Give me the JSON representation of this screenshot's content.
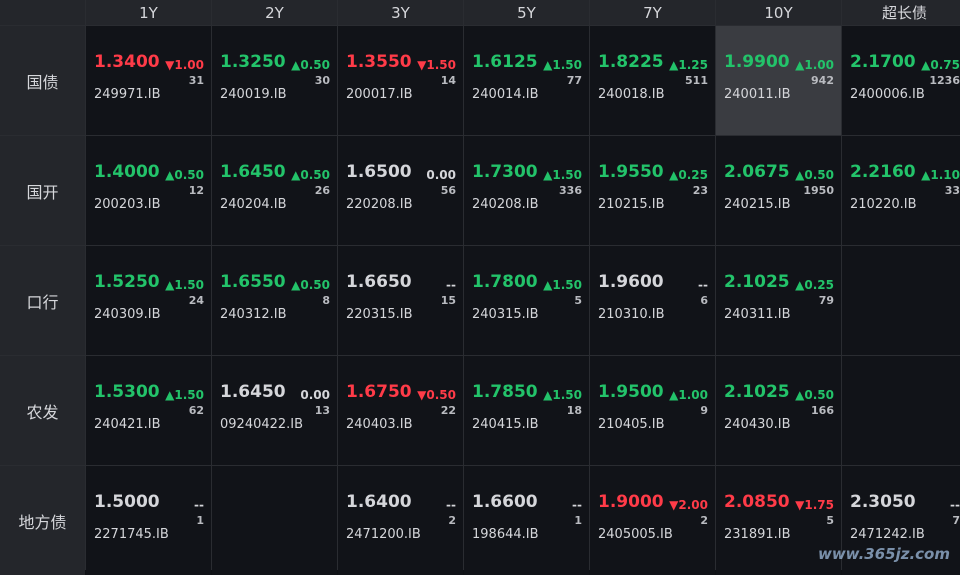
{
  "columns": [
    "1Y",
    "2Y",
    "3Y",
    "5Y",
    "7Y",
    "10Y",
    "超长债"
  ],
  "rows": [
    {
      "label": "国债",
      "cells": [
        {
          "price": "1.3400",
          "change": "▼1.00",
          "volume": "31",
          "code": "249971.IB",
          "dir": "down"
        },
        {
          "price": "1.3250",
          "change": "▲0.50",
          "volume": "30",
          "code": "240019.IB",
          "dir": "up"
        },
        {
          "price": "1.3550",
          "change": "▼1.50",
          "volume": "14",
          "code": "200017.IB",
          "dir": "down"
        },
        {
          "price": "1.6125",
          "change": "▲1.50",
          "volume": "77",
          "code": "240014.IB",
          "dir": "up"
        },
        {
          "price": "1.8225",
          "change": "▲1.25",
          "volume": "511",
          "code": "240018.IB",
          "dir": "up"
        },
        {
          "price": "1.9900",
          "change": "▲1.00",
          "volume": "942",
          "code": "240011.IB",
          "dir": "up",
          "selected": true
        },
        {
          "price": "2.1700",
          "change": "▲0.75",
          "volume": "1236",
          "code": "2400006.IB",
          "dir": "up"
        }
      ]
    },
    {
      "label": "国开",
      "cells": [
        {
          "price": "1.4000",
          "change": "▲0.50",
          "volume": "12",
          "code": "200203.IB",
          "dir": "up"
        },
        {
          "price": "1.6450",
          "change": "▲0.50",
          "volume": "26",
          "code": "240204.IB",
          "dir": "up"
        },
        {
          "price": "1.6500",
          "change": "0.00",
          "volume": "56",
          "code": "220208.IB",
          "dir": "flat"
        },
        {
          "price": "1.7300",
          "change": "▲1.50",
          "volume": "336",
          "code": "240208.IB",
          "dir": "up"
        },
        {
          "price": "1.9550",
          "change": "▲0.25",
          "volume": "23",
          "code": "210215.IB",
          "dir": "up"
        },
        {
          "price": "2.0675",
          "change": "▲0.50",
          "volume": "1950",
          "code": "240215.IB",
          "dir": "up"
        },
        {
          "price": "2.2160",
          "change": "▲1.10",
          "volume": "33",
          "code": "210220.IB",
          "dir": "up"
        }
      ]
    },
    {
      "label": "口行",
      "cells": [
        {
          "price": "1.5250",
          "change": "▲1.50",
          "volume": "24",
          "code": "240309.IB",
          "dir": "up"
        },
        {
          "price": "1.6550",
          "change": "▲0.50",
          "volume": "8",
          "code": "240312.IB",
          "dir": "up"
        },
        {
          "price": "1.6650",
          "change": "--",
          "volume": "15",
          "code": "220315.IB",
          "dir": "flat"
        },
        {
          "price": "1.7800",
          "change": "▲1.50",
          "volume": "5",
          "code": "240315.IB",
          "dir": "up"
        },
        {
          "price": "1.9600",
          "change": "--",
          "volume": "6",
          "code": "210310.IB",
          "dir": "flat"
        },
        {
          "price": "2.1025",
          "change": "▲0.25",
          "volume": "79",
          "code": "240311.IB",
          "dir": "up"
        },
        {
          "price": "",
          "change": "",
          "volume": "",
          "code": "",
          "dir": "flat"
        }
      ]
    },
    {
      "label": "农发",
      "cells": [
        {
          "price": "1.5300",
          "change": "▲1.50",
          "volume": "62",
          "code": "240421.IB",
          "dir": "up"
        },
        {
          "price": "1.6450",
          "change": "0.00",
          "volume": "13",
          "code": "09240422.IB",
          "dir": "flat"
        },
        {
          "price": "1.6750",
          "change": "▼0.50",
          "volume": "22",
          "code": "240403.IB",
          "dir": "down"
        },
        {
          "price": "1.7850",
          "change": "▲1.50",
          "volume": "18",
          "code": "240415.IB",
          "dir": "up"
        },
        {
          "price": "1.9500",
          "change": "▲1.00",
          "volume": "9",
          "code": "210405.IB",
          "dir": "up"
        },
        {
          "price": "2.1025",
          "change": "▲0.50",
          "volume": "166",
          "code": "240430.IB",
          "dir": "up"
        },
        {
          "price": "",
          "change": "",
          "volume": "",
          "code": "",
          "dir": "flat"
        }
      ]
    },
    {
      "label": "地方债",
      "cells": [
        {
          "price": "1.5000",
          "change": "--",
          "volume": "1",
          "code": "2271745.IB",
          "dir": "flat"
        },
        {
          "price": "",
          "change": "",
          "volume": "",
          "code": "",
          "dir": "flat"
        },
        {
          "price": "1.6400",
          "change": "--",
          "volume": "2",
          "code": "2471200.IB",
          "dir": "flat"
        },
        {
          "price": "1.6600",
          "change": "--",
          "volume": "1",
          "code": "198644.IB",
          "dir": "flat"
        },
        {
          "price": "1.9000",
          "change": "▼2.00",
          "volume": "2",
          "code": "2405005.IB",
          "dir": "down"
        },
        {
          "price": "2.0850",
          "change": "▼1.75",
          "volume": "5",
          "code": "231891.IB",
          "dir": "down"
        },
        {
          "price": "2.3050",
          "change": "--",
          "volume": "7",
          "code": "2471242.IB",
          "dir": "flat"
        }
      ]
    }
  ],
  "colors": {
    "up": "#23c36a",
    "down": "#ff3b48",
    "flat": "#d5d6da",
    "selected": "#3a3c41"
  },
  "watermark": "www.365jz.com"
}
